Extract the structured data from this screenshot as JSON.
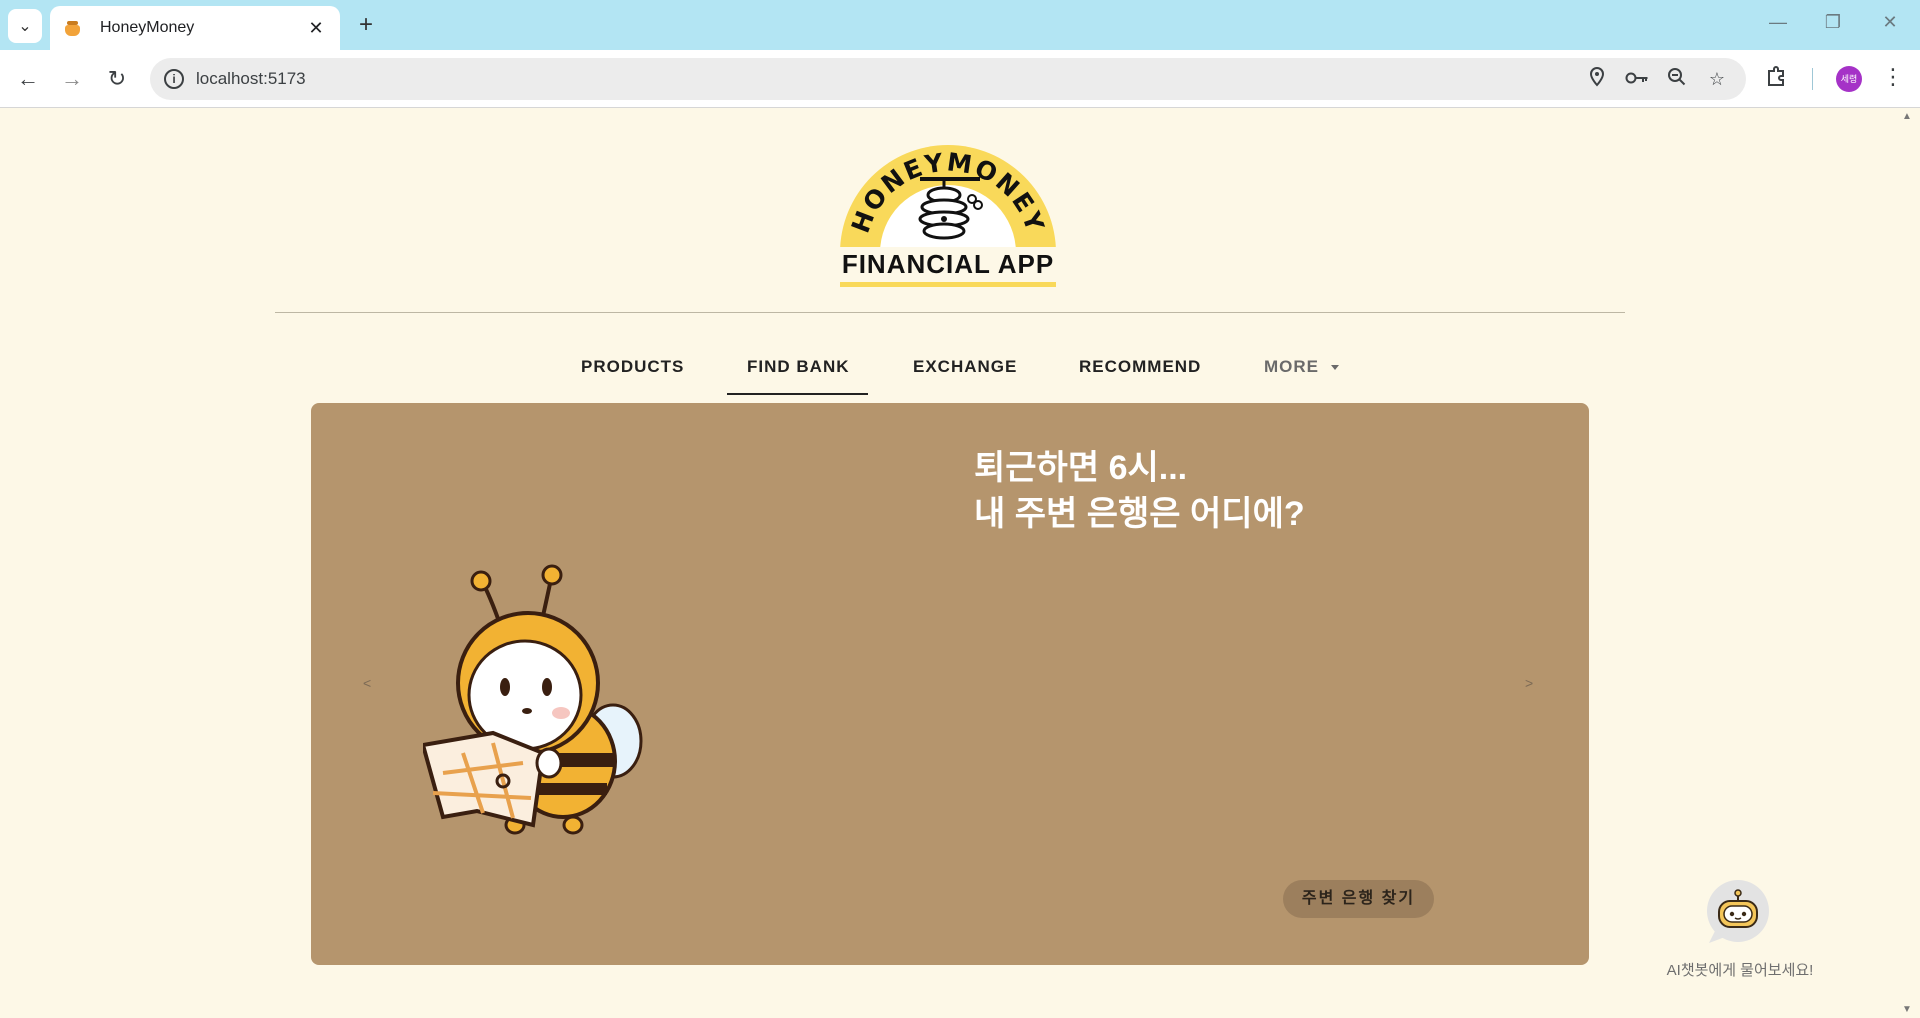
{
  "browser": {
    "tab_title": "HoneyMoney",
    "tab_close": "✕",
    "new_tab": "+",
    "url": "localhost:5173",
    "avatar_text": "세령",
    "window_controls": {
      "minimize": "—",
      "restore": "❐",
      "close": "✕"
    }
  },
  "logo": {
    "arc_text": "HONEYMONEY",
    "subtitle": "FINANCIAL APP"
  },
  "menu": {
    "items": [
      {
        "label": "PRODUCTS"
      },
      {
        "label": "FIND BANK"
      },
      {
        "label": "EXCHANGE"
      },
      {
        "label": "RECOMMEND"
      },
      {
        "label": "MORE"
      }
    ]
  },
  "banner": {
    "line1": "퇴근하면 6시...",
    "line2": "내 주변 은행은 어디에?",
    "prev": "<",
    "next": ">",
    "cta": "주변 은행 찾기",
    "background": "#b5956d"
  },
  "chatbot": {
    "label": "AI챗봇에게 물어보세요!"
  },
  "colors": {
    "page_bg": "#fdf8e7",
    "tabbar_bg": "#b3e5f3",
    "logo_yellow": "#f9d95a"
  }
}
